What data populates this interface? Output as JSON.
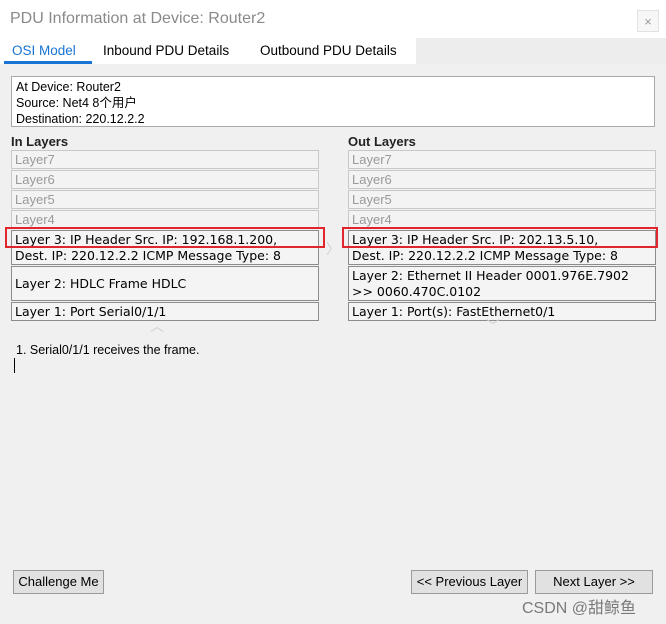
{
  "window": {
    "title": "PDU Information at Device: Router2",
    "close_glyph": "×"
  },
  "tabs": [
    {
      "label": "OSI Model",
      "active": true
    },
    {
      "label": "Inbound PDU Details",
      "active": false
    },
    {
      "label": "Outbound PDU Details",
      "active": false
    }
  ],
  "info": {
    "device": "At Device: Router2",
    "source": "Source: Net4 8个用户",
    "destination": "Destination: 220.12.2.2"
  },
  "in_layers": {
    "heading": "In Layers",
    "layer7": "Layer7",
    "layer6": "Layer6",
    "layer5": "Layer5",
    "layer4": "Layer4",
    "layer3_line1": "Layer 3: IP Header Src. IP: 192.168.1.200,",
    "layer3_line2": "Dest. IP: 220.12.2.2 ICMP Message Type: 8",
    "layer2": "Layer 2: HDLC Frame HDLC",
    "layer1": "Layer 1: Port Serial0/1/1"
  },
  "out_layers": {
    "heading": "Out Layers",
    "layer7": "Layer7",
    "layer6": "Layer6",
    "layer5": "Layer5",
    "layer4": "Layer4",
    "layer3_line1": "Layer 3: IP Header Src. IP: 202.13.5.10,",
    "layer3_line2": "Dest. IP: 220.12.2.2 ICMP Message Type: 8",
    "layer2_line1": "Layer 2: Ethernet II Header 0001.976E.7902",
    "layer2_line2": ">> 0060.470C.0102",
    "layer1": "Layer 1: Port(s): FastEthernet0/1"
  },
  "description": {
    "step1": "1. Serial0/1/1 receives the frame."
  },
  "buttons": {
    "challenge": "Challenge Me",
    "previous": "<< Previous Layer",
    "next": "Next Layer >>"
  },
  "watermark": "CSDN @甜鲸鱼",
  "colors": {
    "accent": "#1874d4",
    "highlight": "#e0262b"
  },
  "icons": {
    "close": "close-icon",
    "up_arrow": "up-chevron-icon",
    "down_arrow": "down-chevron-icon",
    "right_arrow": "right-chevron-icon"
  }
}
